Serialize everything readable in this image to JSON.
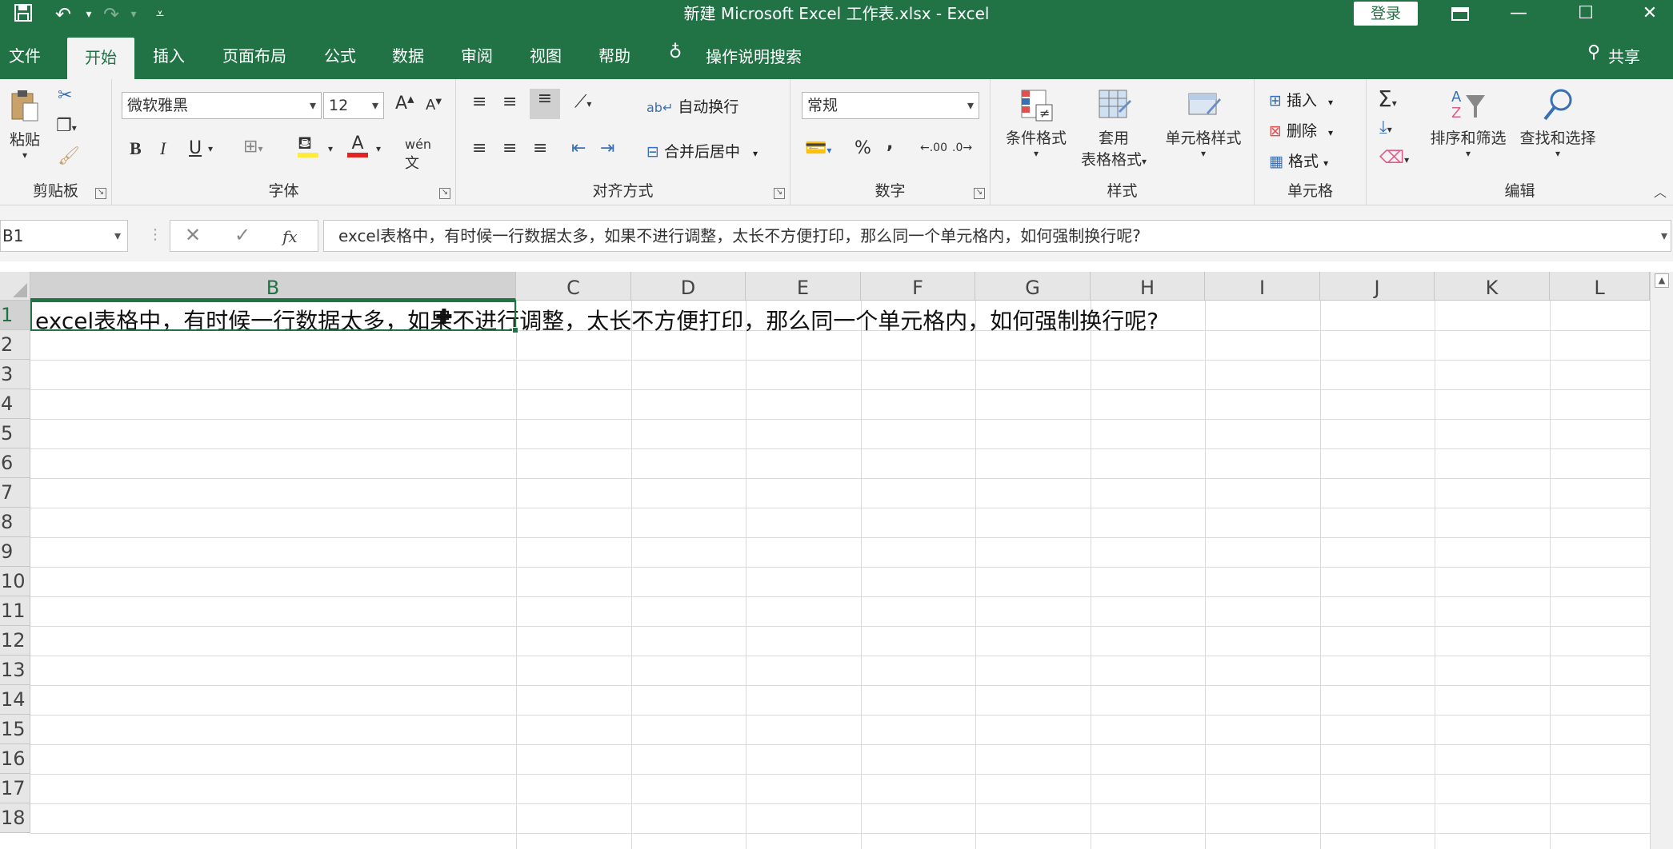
{
  "titlebar": {
    "title": "新建 Microsoft Excel 工作表.xlsx  -  Excel",
    "login": "登录",
    "save_icon": "save-icon",
    "undo_icon": "undo-icon",
    "redo_icon": "redo-icon",
    "customize_icon": "customize-icon"
  },
  "tabs": [
    {
      "label": "文件"
    },
    {
      "label": "开始"
    },
    {
      "label": "插入"
    },
    {
      "label": "页面布局"
    },
    {
      "label": "公式"
    },
    {
      "label": "数据"
    },
    {
      "label": "审阅"
    },
    {
      "label": "视图"
    },
    {
      "label": "帮助"
    }
  ],
  "tell_me": "操作说明搜索",
  "share": "共享",
  "ribbon": {
    "clipboard": {
      "paste": "粘贴",
      "label": "剪贴板"
    },
    "font": {
      "name": "微软雅黑",
      "size": "12",
      "bold": "B",
      "italic": "I",
      "underline": "U",
      "label": "字体"
    },
    "alignment": {
      "wrap": "自动换行",
      "merge": "合并后居中",
      "label": "对齐方式"
    },
    "number": {
      "format": "常规",
      "percent": "%",
      "comma": ",",
      "inc": ".00",
      "dec": ".0",
      "label": "数字"
    },
    "styles": {
      "conditional": "条件格式",
      "table_1": "套用",
      "table_2": "表格格式",
      "cell_styles": "单元格样式",
      "label": "样式"
    },
    "cells": {
      "insert": "插入",
      "delete": "删除",
      "format": "格式",
      "label": "单元格"
    },
    "editing": {
      "sort": "排序和筛选",
      "find": "查找和选择",
      "label": "编辑"
    }
  },
  "formula_bar": {
    "name_box": "B1",
    "fx": "fx",
    "content": "excel表格中，有时候一行数据太多，如果不进行调整，太长不方便打印，那么同一个单元格内，如何强制换行呢?"
  },
  "sheet": {
    "columns": [
      "B",
      "C",
      "D",
      "E",
      "F",
      "G",
      "H",
      "I",
      "J",
      "K",
      "L"
    ],
    "rows": [
      "1",
      "2",
      "3",
      "4",
      "5",
      "6",
      "7",
      "8",
      "9",
      "10",
      "11",
      "12",
      "13",
      "14",
      "15",
      "16",
      "17",
      "18"
    ],
    "selected_column": "B",
    "selected_row": "1",
    "cell_b1": "excel表格中，有时候一行数据太多，如果不进行调整，太长不方便打印，那么同一个单元格内，如何强制换行呢?"
  }
}
